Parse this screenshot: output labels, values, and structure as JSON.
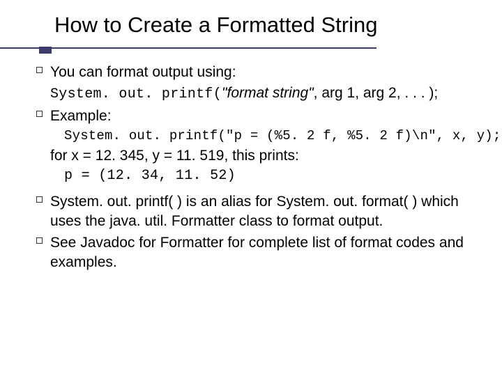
{
  "title": "How to Create a Formatted String",
  "items": {
    "i1_a": "You can format output using:",
    "i1_b_mono": "System. out. printf(",
    "i1_b_ital": "\"format string\"",
    "i1_b_tail": ", arg 1, arg 2, . . . );",
    "i2_a": "Example:",
    "i2_code": "System. out. printf(\"p = (%5. 2 f, %5. 2 f)\\n\", x, y);",
    "i2_mid": "for x = 12. 345, y = 11. 519, this prints:",
    "i2_out": "p = (12. 34, 11. 52)",
    "i3": "System. out. printf( ) is an alias for System. out. format( ) which uses the java. util. Formatter class to format output.",
    "i4": "See Javadoc for Formatter for complete list of format codes and examples."
  }
}
